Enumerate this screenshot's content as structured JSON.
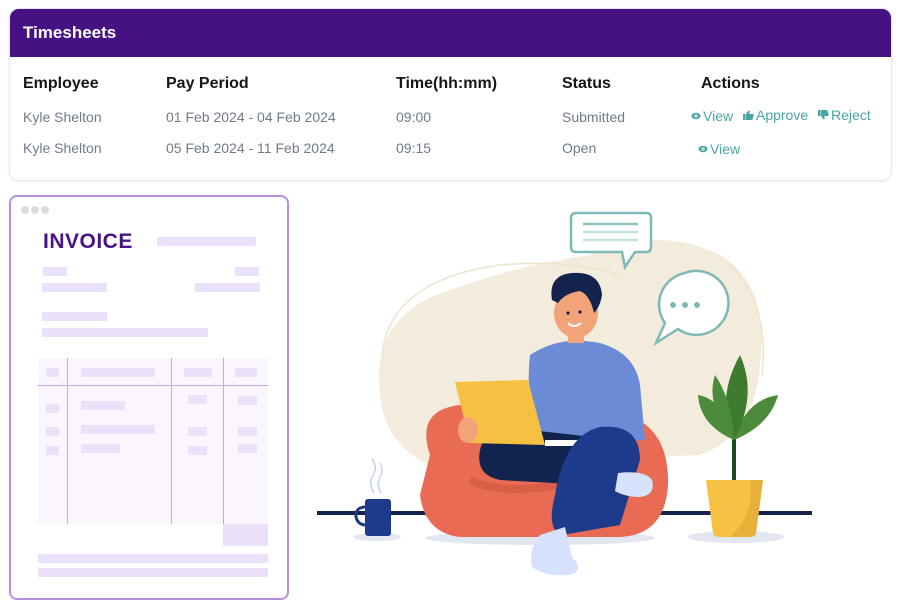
{
  "card": {
    "title": "Timesheets",
    "columns": [
      "Employee",
      "Pay Period",
      "Time(hh:mm)",
      "Status",
      "Actions"
    ],
    "rows": [
      {
        "employee": "Kyle Shelton",
        "pay_period": "01 Feb 2024 - 04 Feb 2024",
        "time": "09:00",
        "status": "Submitted",
        "actions": [
          {
            "icon": "eye-icon",
            "label": "View"
          },
          {
            "icon": "thumbs-up-icon",
            "label": "Approve"
          },
          {
            "icon": "thumbs-down-icon",
            "label": "Reject"
          }
        ]
      },
      {
        "employee": "Kyle Shelton",
        "pay_period": "05 Feb 2024 - 11 Feb 2024",
        "time": "09:15",
        "status": "Open",
        "actions": [
          {
            "icon": "eye-icon",
            "label": "View"
          }
        ]
      }
    ]
  },
  "invoice": {
    "title": "INVOICE"
  },
  "colors": {
    "header_bg": "#461283",
    "action_teal": "#4aa5a2",
    "invoice_border": "#b88ee3",
    "invoice_title": "#4a1487",
    "muted_text": "#707b88"
  }
}
